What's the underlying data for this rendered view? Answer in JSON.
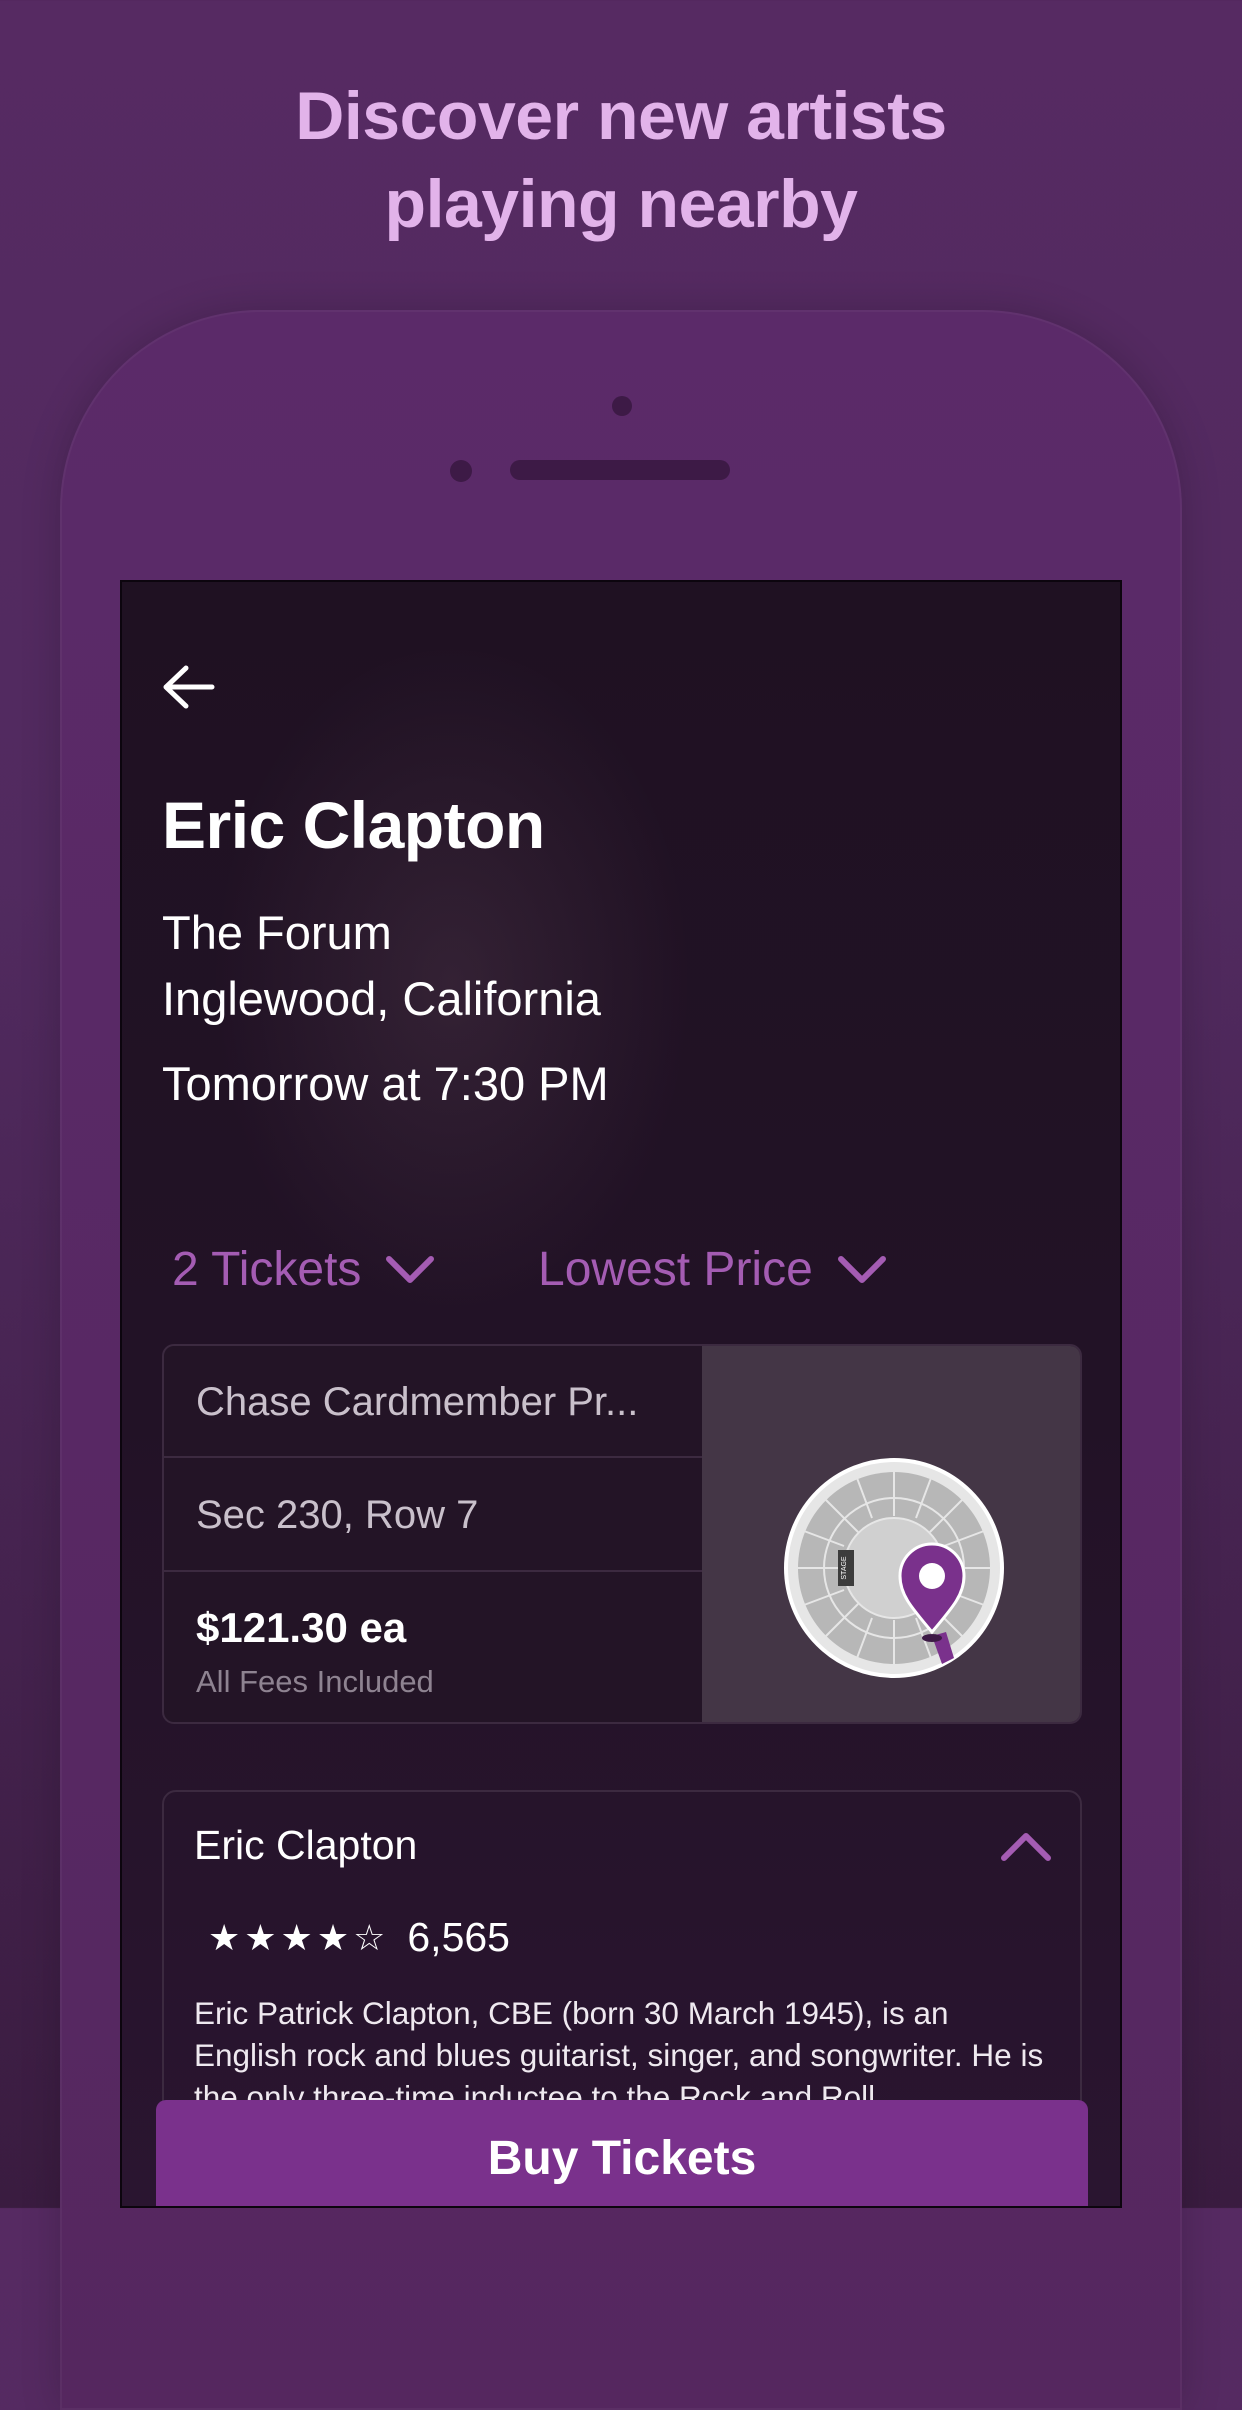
{
  "headline": {
    "line1": "Discover new artists",
    "line2": "playing nearby"
  },
  "event": {
    "artist": "Eric Clapton",
    "venue_name": "The Forum",
    "venue_location": "Inglewood, California",
    "time": "Tomorrow at 7:30 PM"
  },
  "filters": {
    "tickets_label": "2 Tickets",
    "sort_label": "Lowest Price"
  },
  "listing": {
    "seller": "Chase Cardmember Pr...",
    "seat": "Sec 230, Row 7",
    "price": "$121.30 ea",
    "fees_note": "All Fees Included",
    "map_stage_label": "STAGE"
  },
  "about": {
    "title": "Eric Clapton",
    "stars": "★★★★☆",
    "rating_count": "6,565",
    "bio": "Eric Patrick Clapton, CBE (born 30 March 1945), is an English rock and blues guitarist, singer, and songwriter. He is the only three-time inductee to the Rock and Roll"
  },
  "buy_button": "Buy Tickets",
  "colors": {
    "accent": "#a45cb3",
    "button": "#7a318c",
    "headline": "#e2b3ea",
    "background": "#562a62"
  }
}
